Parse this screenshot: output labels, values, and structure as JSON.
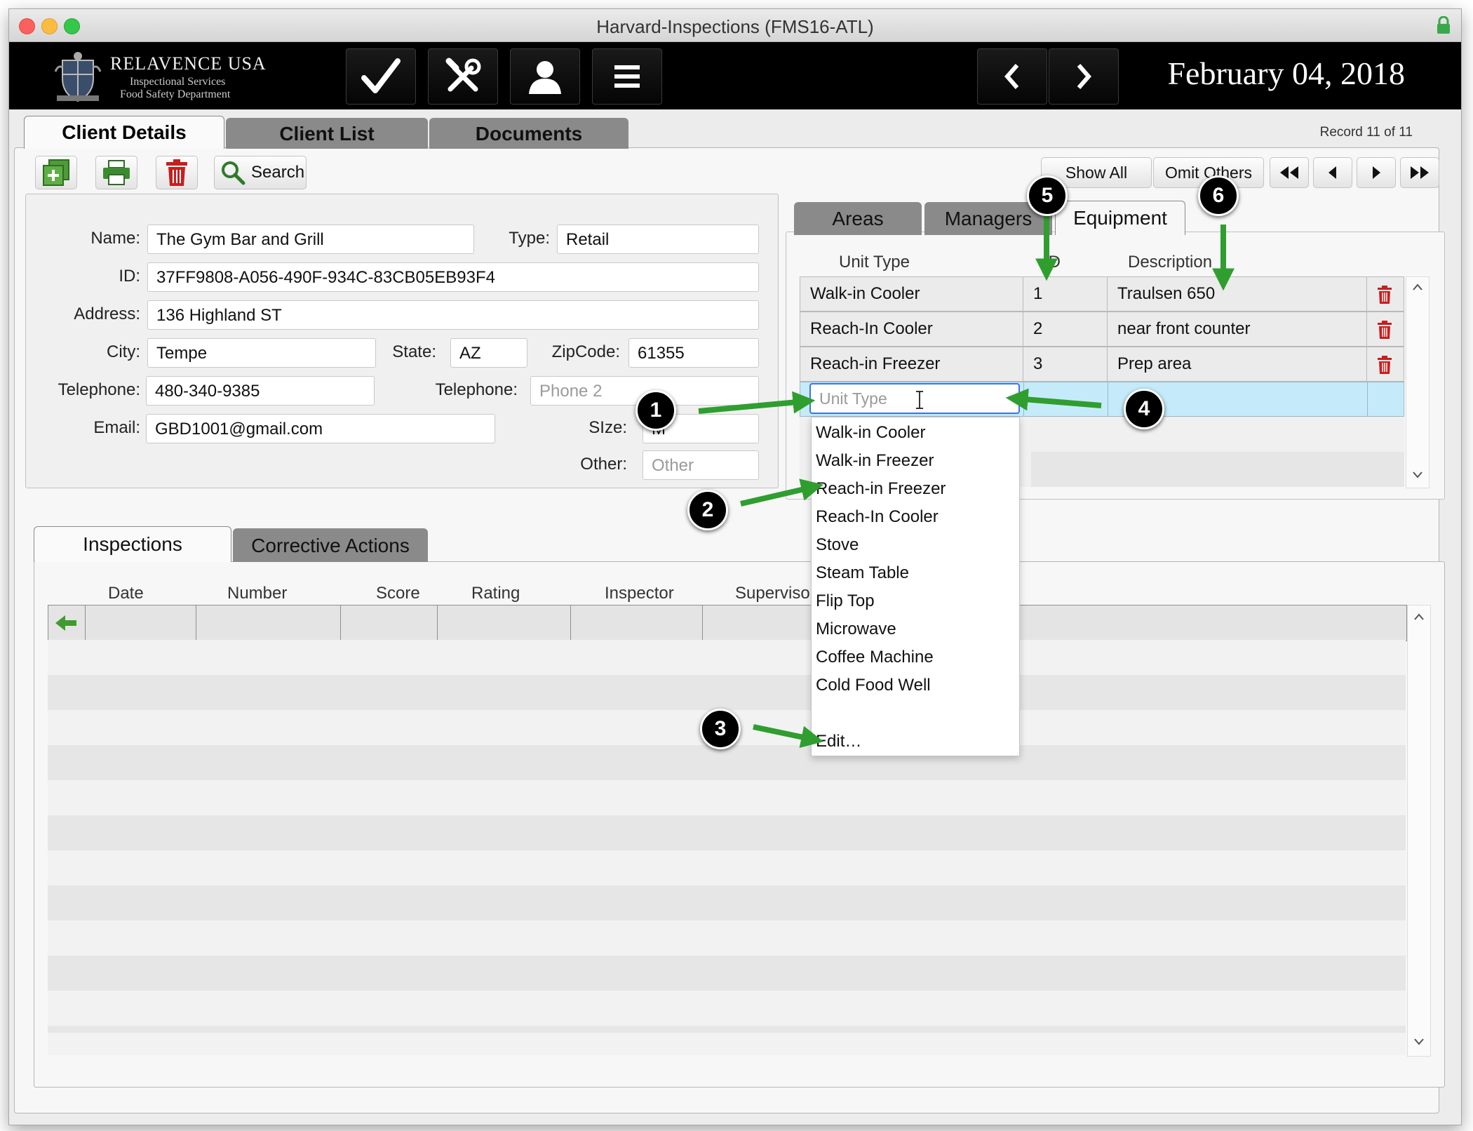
{
  "window": {
    "title": "Harvard-Inspections (FMS16-ATL)"
  },
  "brand": {
    "name": "RELAVENCE USA",
    "line1": "Inspectional Services",
    "line2": "Food Safety Department"
  },
  "header": {
    "date": "February 04, 2018"
  },
  "icons": {
    "header": [
      "checkmark-icon",
      "tools-icon",
      "user-icon",
      "menu-icon",
      "chevron-left-icon",
      "chevron-right-icon"
    ],
    "toolbar": [
      "new-record-icon",
      "print-icon",
      "trash-icon",
      "search-icon"
    ]
  },
  "main_tabs": [
    "Client Details",
    "Client List",
    "Documents"
  ],
  "record_count": "Record 11 of 11",
  "toolbar": {
    "search_label": "Search",
    "show_all": "Show All",
    "omit_others": "Omit Others"
  },
  "client": {
    "labels": {
      "name": "Name:",
      "type": "Type:",
      "id": "ID:",
      "address": "Address:",
      "city": "City:",
      "state": "State:",
      "zip": "ZipCode:",
      "telephone": "Telephone:",
      "telephone2": "Telephone:",
      "email": "Email:",
      "size": "SIze:",
      "other": "Other:"
    },
    "values": {
      "name": "The Gym Bar and Grill",
      "type": "Retail",
      "id": "37FF9808-A056-490F-934C-83CB05EB93F4",
      "address": "136 Highland ST",
      "city": "Tempe",
      "state": "AZ",
      "zip": "61355",
      "telephone": "480-340-9385",
      "email": "GBD1001@gmail.com",
      "size": "M"
    },
    "placeholders": {
      "telephone2": "Phone 2",
      "other": "Other"
    }
  },
  "equipment": {
    "tabs": [
      "Areas",
      "Managers",
      "Equipment"
    ],
    "columns": [
      "Unit Type",
      "ID",
      "Description"
    ],
    "rows": [
      {
        "unit_type": "Walk-in Cooler",
        "id": "1",
        "description": "Traulsen 650"
      },
      {
        "unit_type": "Reach-In Cooler",
        "id": "2",
        "description": "near front counter"
      },
      {
        "unit_type": "Reach-in Freezer",
        "id": "3",
        "description": "Prep area"
      }
    ],
    "new_row_placeholder": "Unit Type",
    "dropdown_options": [
      "Walk-in Cooler",
      "Walk-in Freezer",
      "Reach-in Freezer",
      "Reach-In Cooler",
      "Stove",
      "Steam Table",
      "Flip Top",
      "Microwave",
      "Coffee Machine",
      "Cold Food Well"
    ],
    "dropdown_edit": "Edit…"
  },
  "inspections": {
    "tabs": [
      "Inspections",
      "Corrective Actions"
    ],
    "columns": [
      "Date",
      "Number",
      "Score",
      "Rating",
      "Inspector",
      "Supervisor"
    ]
  },
  "callouts": [
    "1",
    "2",
    "3",
    "4",
    "5",
    "6"
  ],
  "colors": {
    "arrow_green": "#2f9e2f",
    "trash_red": "#c81e1e",
    "selected_row": "#c5ebfa",
    "header_bg": "#000000"
  }
}
